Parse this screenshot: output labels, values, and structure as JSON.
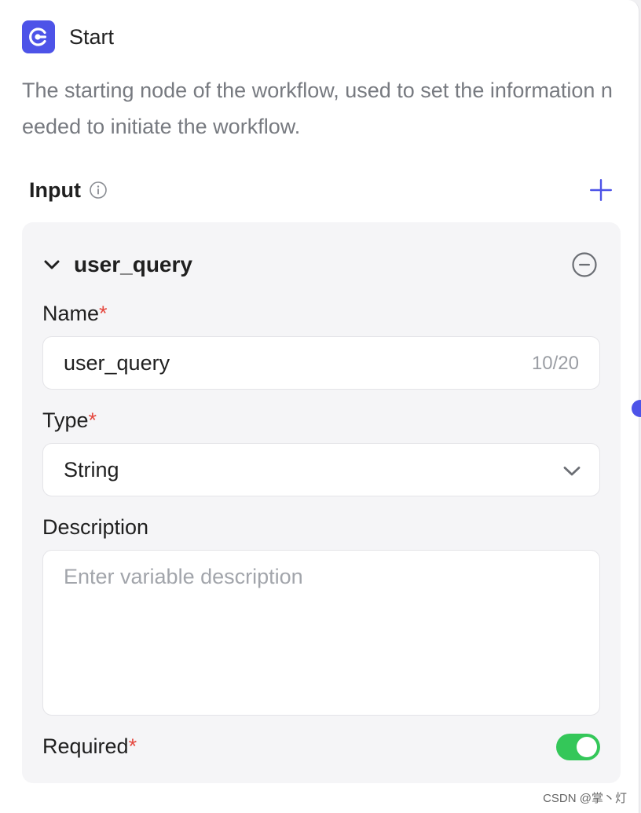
{
  "node": {
    "title": "Start",
    "description": "The starting node of the workflow, used to set the information needed to initiate the workflow."
  },
  "input_section": {
    "label": "Input"
  },
  "variable": {
    "title": "user_query",
    "name_label": "Name",
    "required_mark": "*",
    "name_value": "user_query",
    "name_count": "10/20",
    "type_label": "Type",
    "type_value": "String",
    "description_label": "Description",
    "description_placeholder": "Enter variable description",
    "description_value": "",
    "required_label": "Required",
    "required_on": true
  },
  "colors": {
    "accent": "#4d53e8",
    "toggle_on": "#34c759",
    "required_star": "#e5483f"
  },
  "watermark": "CSDN @掌丶灯"
}
